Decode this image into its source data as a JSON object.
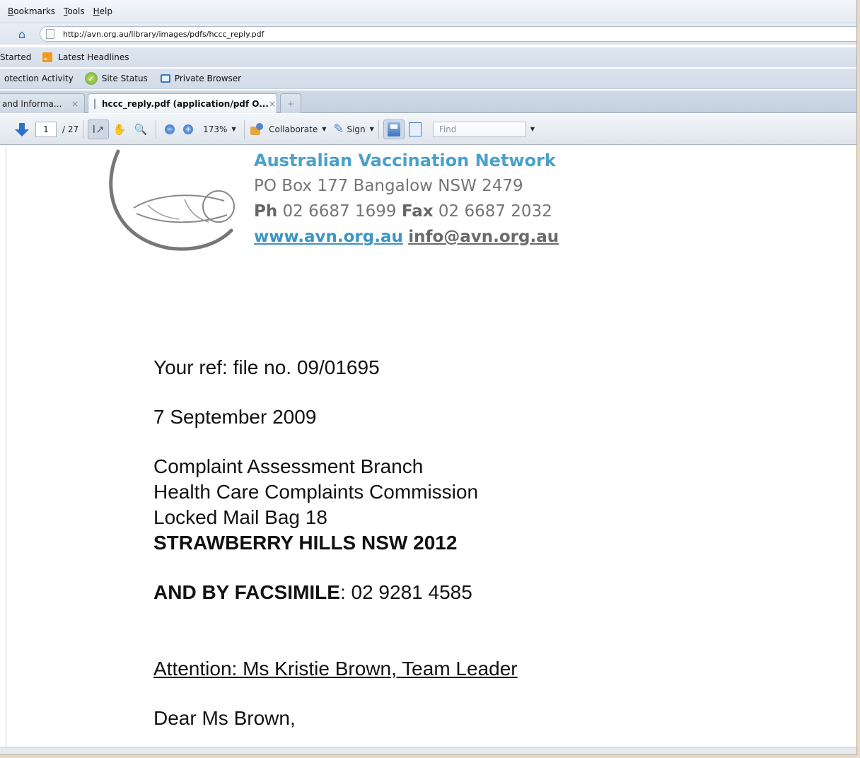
{
  "menu": {
    "items": [
      "Bookmarks",
      "Tools",
      "Help"
    ]
  },
  "nav": {
    "url": "http://avn.org.au/library/images/pdfs/hccc_reply.pdf"
  },
  "bookmarks": {
    "items": [
      "Started",
      "Latest Headlines"
    ]
  },
  "addons": {
    "items": [
      "otection Activity",
      "Site Status",
      "Private Browser"
    ]
  },
  "tabs": [
    {
      "label": "and Informa...",
      "close": "×"
    },
    {
      "label": "hccc_reply.pdf (application/pdf O...",
      "close": "×"
    },
    {
      "label": "+"
    }
  ],
  "pdf_toolbar": {
    "page_current": "1",
    "page_total": "/ 27",
    "zoom": "173%",
    "collaborate_label": "Collaborate",
    "sign_label": "Sign",
    "find_placeholder": "Find"
  },
  "letterhead": {
    "org_name": "Australian Vaccination Network",
    "address": "PO Box 177 Bangalow NSW 2479",
    "ph_label": "Ph",
    "ph_number": "02 6687 1699",
    "fax_label": "Fax",
    "fax_number": "02 6687 2032",
    "website": "www.avn.org.au",
    "email": "info@avn.org.au"
  },
  "letter": {
    "ref": "Your ref: file no. 09/01695",
    "date": "7 September 2009",
    "addr1": "Complaint Assessment Branch",
    "addr2": "Health Care Complaints Commission",
    "addr3": "Locked Mail Bag 18",
    "addr4": "STRAWBERRY HILLS NSW 2012",
    "fax_label": "AND BY FACSIMILE",
    "fax_number": ": 02 9281 4585",
    "attention": "Attention: Ms Kristie Brown, Team Leader",
    "salutation": "Dear Ms Brown,"
  }
}
